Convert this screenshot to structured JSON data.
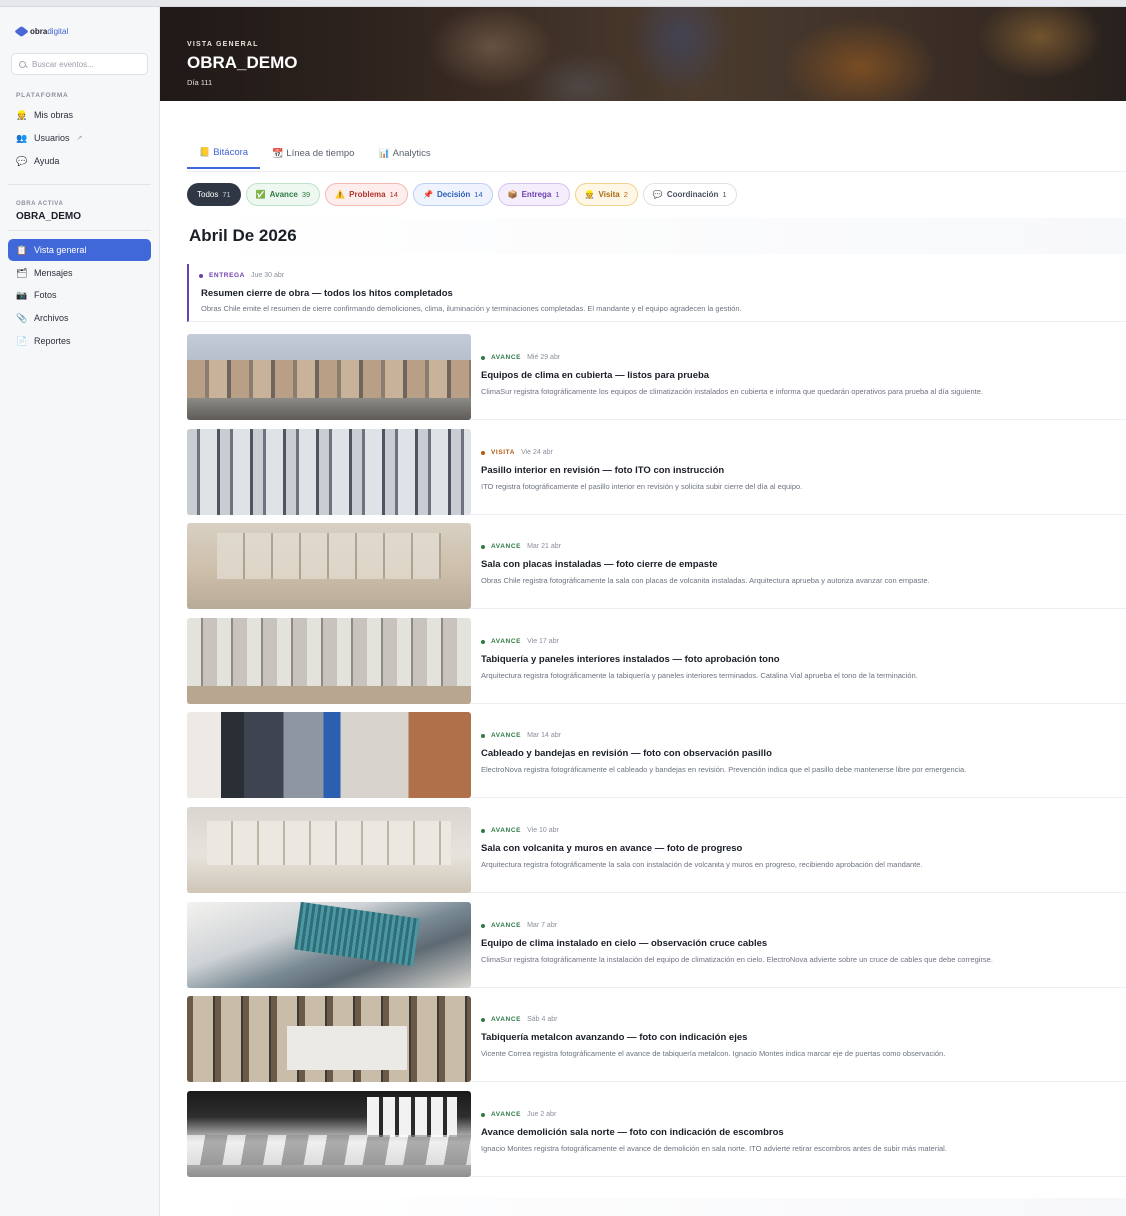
{
  "brand": {
    "name_dark": "obra",
    "name_accent": "digital"
  },
  "search": {
    "placeholder": "Buscar eventos..."
  },
  "sidebar": {
    "platform_label": "PLATAFORMA",
    "platform_items": [
      {
        "label": "Mis obras",
        "icon": "builder-icon",
        "glyph": "👷"
      },
      {
        "label": "Usuarios",
        "icon": "users-icon",
        "glyph": "👥",
        "ext": "↗"
      },
      {
        "label": "Ayuda",
        "icon": "speech-bubble-icon",
        "glyph": "💬"
      }
    ],
    "active_project_label": "OBRA ACTIVA",
    "active_project_name": "OBRA_DEMO",
    "project_items": [
      {
        "label": "Vista general",
        "icon": "clipboard-icon",
        "glyph": "📋",
        "active": true
      },
      {
        "label": "Mensajes",
        "icon": "folder-icon",
        "glyph": "🗂"
      },
      {
        "label": "Fotos",
        "icon": "camera-icon",
        "glyph": "📷"
      },
      {
        "label": "Archivos",
        "icon": "paperclip-icon",
        "glyph": "📎"
      },
      {
        "label": "Reportes",
        "icon": "document-icon",
        "glyph": "📄"
      }
    ]
  },
  "hero": {
    "eyebrow": "VISTA GENERAL",
    "title": "OBRA_DEMO",
    "subtitle": "Día 111"
  },
  "tabs": [
    {
      "label": "Bitácora",
      "glyph": "📒",
      "active": true
    },
    {
      "label": "Línea de tiempo",
      "glyph": "📆"
    },
    {
      "label": "Analytics",
      "glyph": "📊"
    }
  ],
  "filters": [
    {
      "label": "Todos",
      "count": "71",
      "glyph": "",
      "color": "#2f3744",
      "bg": "#2f3744",
      "border": "#2f3744"
    },
    {
      "label": "Avance",
      "count": "39",
      "glyph": "✅",
      "color": "#2f7a45",
      "bg": "#eef8f0",
      "border": "#bfe3c8"
    },
    {
      "label": "Problema",
      "count": "14",
      "glyph": "⚠️",
      "color": "#b3322a",
      "bg": "#fdeeed",
      "border": "#f3b9b4"
    },
    {
      "label": "Decisión",
      "count": "14",
      "glyph": "📌",
      "color": "#2f5fb8",
      "bg": "#eef3fd",
      "border": "#bdd0f3"
    },
    {
      "label": "Entrega",
      "count": "1",
      "glyph": "📦",
      "color": "#6e3fb0",
      "bg": "#f4eefc",
      "border": "#d6c4f0"
    },
    {
      "label": "Visita",
      "count": "2",
      "glyph": "👷",
      "color": "#a86a12",
      "bg": "#fff7e6",
      "border": "#f1d38f"
    },
    {
      "label": "Coordinación",
      "count": "1",
      "glyph": "💬",
      "color": "#4a5060",
      "bg": "#ffffff",
      "border": "#dfe1e6"
    }
  ],
  "month": "Abril De 2026",
  "entrega": {
    "type": "ENTREGA",
    "type_color": "#6e3fb0",
    "date": "Jue 30 abr",
    "title": "Resumen cierre de obra — todos los hitos completados",
    "desc": "Obras Chile emite el resumen de cierre confirmando demoliciones, clima, iluminación y terminaciones completadas. El mandante y el equipo agradecen la gestión."
  },
  "events": [
    {
      "type": "AVANCE",
      "type_color": "#2f7a45",
      "date": "Mié 29 abr",
      "title": "Equipos de clima en cubierta — listos para prueba",
      "desc": "ClimaSur registra fotográficamente los equipos de climatización instalados en cubierta e informa que quedarán operativos para prueba al día siguiente.",
      "photo": "p1"
    },
    {
      "type": "VISITA",
      "type_color": "#b35a12",
      "date": "Vie 24 abr",
      "title": "Pasillo interior en revisión — foto ITO con instrucción",
      "desc": "ITO registra fotográficamente el pasillo interior en revisión y solicita subir cierre del día al equipo.",
      "photo": "p2"
    },
    {
      "type": "AVANCE",
      "type_color": "#2f7a45",
      "date": "Mar 21 abr",
      "title": "Sala con placas instaladas — foto cierre de empaste",
      "desc": "Obras Chile registra fotográficamente la sala con placas de volcanita instaladas. Arquitectura aprueba y autoriza avanzar con empaste.",
      "photo": "p3"
    },
    {
      "type": "AVANCE",
      "type_color": "#2f7a45",
      "date": "Vie 17 abr",
      "title": "Tabiquería y paneles interiores instalados — foto aprobación tono",
      "desc": "Arquitectura registra fotográficamente la tabiquería y paneles interiores terminados. Catalina Vial aprueba el tono de la terminación.",
      "photo": "p4"
    },
    {
      "type": "AVANCE",
      "type_color": "#2f7a45",
      "date": "Mar 14 abr",
      "title": "Cableado y bandejas en revisión — foto con observación pasillo",
      "desc": "ElectroNova registra fotográficamente el cableado y bandejas en revisión. Prevención indica que el pasillo debe mantenerse libre por emergencia.",
      "photo": "p5"
    },
    {
      "type": "AVANCE",
      "type_color": "#2f7a45",
      "date": "Vie 10 abr",
      "title": "Sala con volcanita y muros en avance — foto de progreso",
      "desc": "Arquitectura registra fotográficamente la sala con instalación de volcanita y muros en progreso, recibiendo aprobación del mandante.",
      "photo": "p6"
    },
    {
      "type": "AVANCE",
      "type_color": "#2f7a45",
      "date": "Mar 7 abr",
      "title": "Equipo de clima instalado en cielo — observación cruce cables",
      "desc": "ClimaSur registra fotográficamente la instalación del equipo de climatización en cielo. ElectroNova advierte sobre un cruce de cables que debe corregirse.",
      "photo": "p7"
    },
    {
      "type": "AVANCE",
      "type_color": "#2f7a45",
      "date": "Sáb 4 abr",
      "title": "Tabiquería metalcon avanzando — foto con indicación ejes",
      "desc": "Vicente Correa registra fotográficamente el avance de tabiquería metalcon. Ignacio Montes indica marcar eje de puertas como observación.",
      "photo": "p8"
    },
    {
      "type": "AVANCE",
      "type_color": "#2f7a45",
      "date": "Jue 2 abr",
      "title": "Avance demolición sala norte — foto con indicación de escombros",
      "desc": "Ignacio Montes registra fotográficamente el avance de demolición en sala norte. ITO advierte retirar escombros antes de subir más material.",
      "photo": "p9"
    }
  ]
}
